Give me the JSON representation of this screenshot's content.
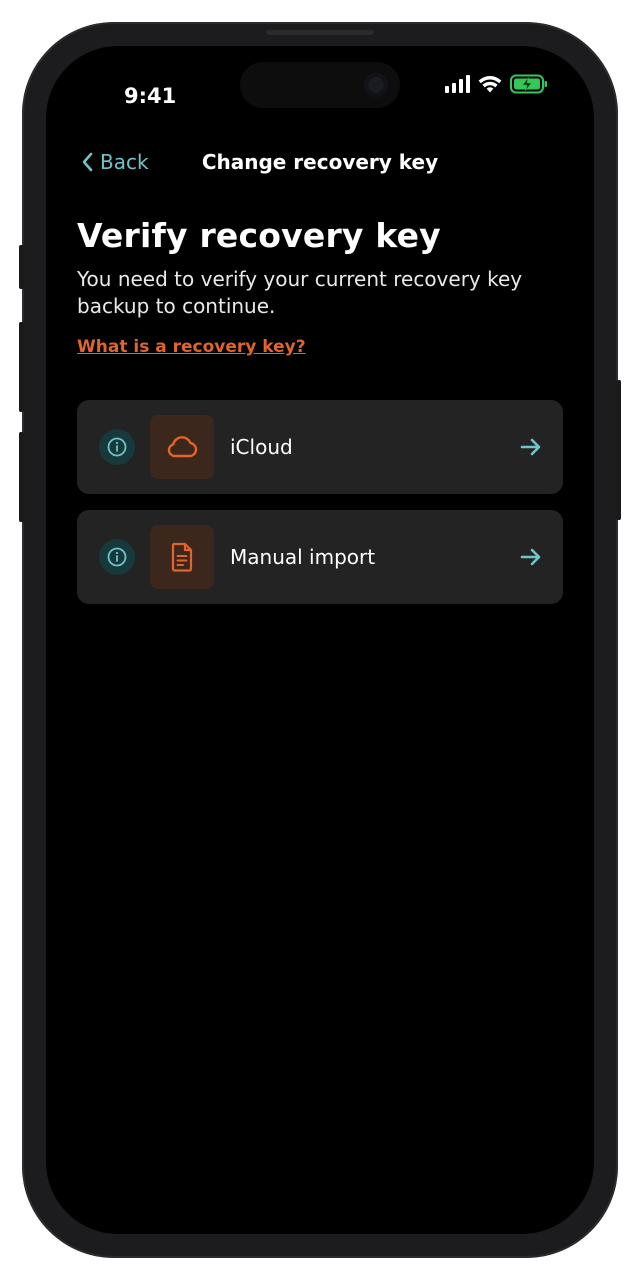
{
  "status_bar": {
    "time": "9:41",
    "signal_icon": "cellular-signal-icon",
    "wifi_icon": "wifi-icon",
    "battery_icon": "battery-charging-icon"
  },
  "nav": {
    "back_label": "Back",
    "title": "Change recovery key"
  },
  "page": {
    "heading": "Verify recovery key",
    "description": "You need to verify your current recovery key backup to continue.",
    "help_link": "What is a recovery key?"
  },
  "options": [
    {
      "label": "iCloud",
      "icon": "cloud-icon"
    },
    {
      "label": "Manual import",
      "icon": "document-icon"
    }
  ],
  "colors": {
    "accent_teal": "#6fc4c9",
    "accent_orange": "#e0642c",
    "card_background": "#232323",
    "screen_background": "#000000",
    "battery_green": "#34c759"
  }
}
